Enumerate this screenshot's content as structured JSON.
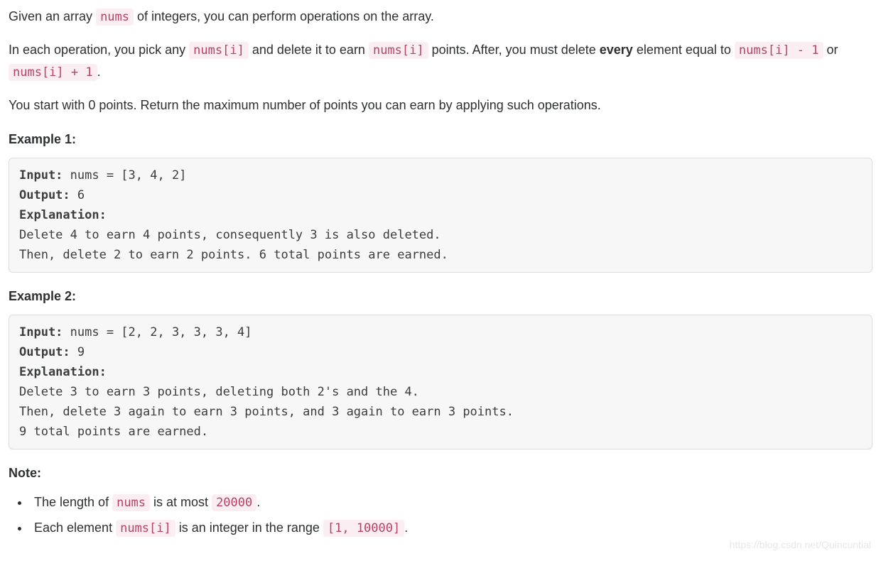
{
  "para1": {
    "pre": "Given an array ",
    "c1": "nums",
    "post": " of integers, you can perform operations on the array."
  },
  "para2": {
    "t1": "In each operation, you pick any ",
    "c1": "nums[i]",
    "t2": " and delete it to earn ",
    "c2": "nums[i]",
    "t3": " points. After, you must delete ",
    "bold": "every",
    "t4": " element equal to ",
    "c3": "nums[i] - 1",
    "t5": " or ",
    "c4": "nums[i] + 1",
    "t6": "."
  },
  "para3": "You start with 0 points. Return the maximum number of points you can earn by applying such operations.",
  "ex1": {
    "title": "Example 1:",
    "labels": {
      "input": "Input:",
      "output": "Output:",
      "explanation": "Explanation:"
    },
    "input": " nums = [3, 4, 2]",
    "output": " 6",
    "explain1": "Delete 4 to earn 4 points, consequently 3 is also deleted.",
    "explain2": "Then, delete 2 to earn 2 points. 6 total points are earned."
  },
  "ex2": {
    "title": "Example 2:",
    "labels": {
      "input": "Input:",
      "output": "Output:",
      "explanation": "Explanation:"
    },
    "input": " nums = [2, 2, 3, 3, 3, 4]",
    "output": " 9",
    "explain1": "Delete 3 to earn 3 points, deleting both 2's and the 4.",
    "explain2": "Then, delete 3 again to earn 3 points, and 3 again to earn 3 points.",
    "explain3": "9 total points are earned."
  },
  "note": {
    "title": "Note:",
    "li1": {
      "t1": "The length of ",
      "c1": "nums",
      "t2": " is at most ",
      "c2": "20000",
      "t3": "."
    },
    "li2": {
      "t1": "Each element ",
      "c1": "nums[i]",
      "t2": " is an integer in the range ",
      "c2": "[1, 10000]",
      "t3": "."
    }
  },
  "watermark": "https://blog.csdn.net/Quincuntial"
}
